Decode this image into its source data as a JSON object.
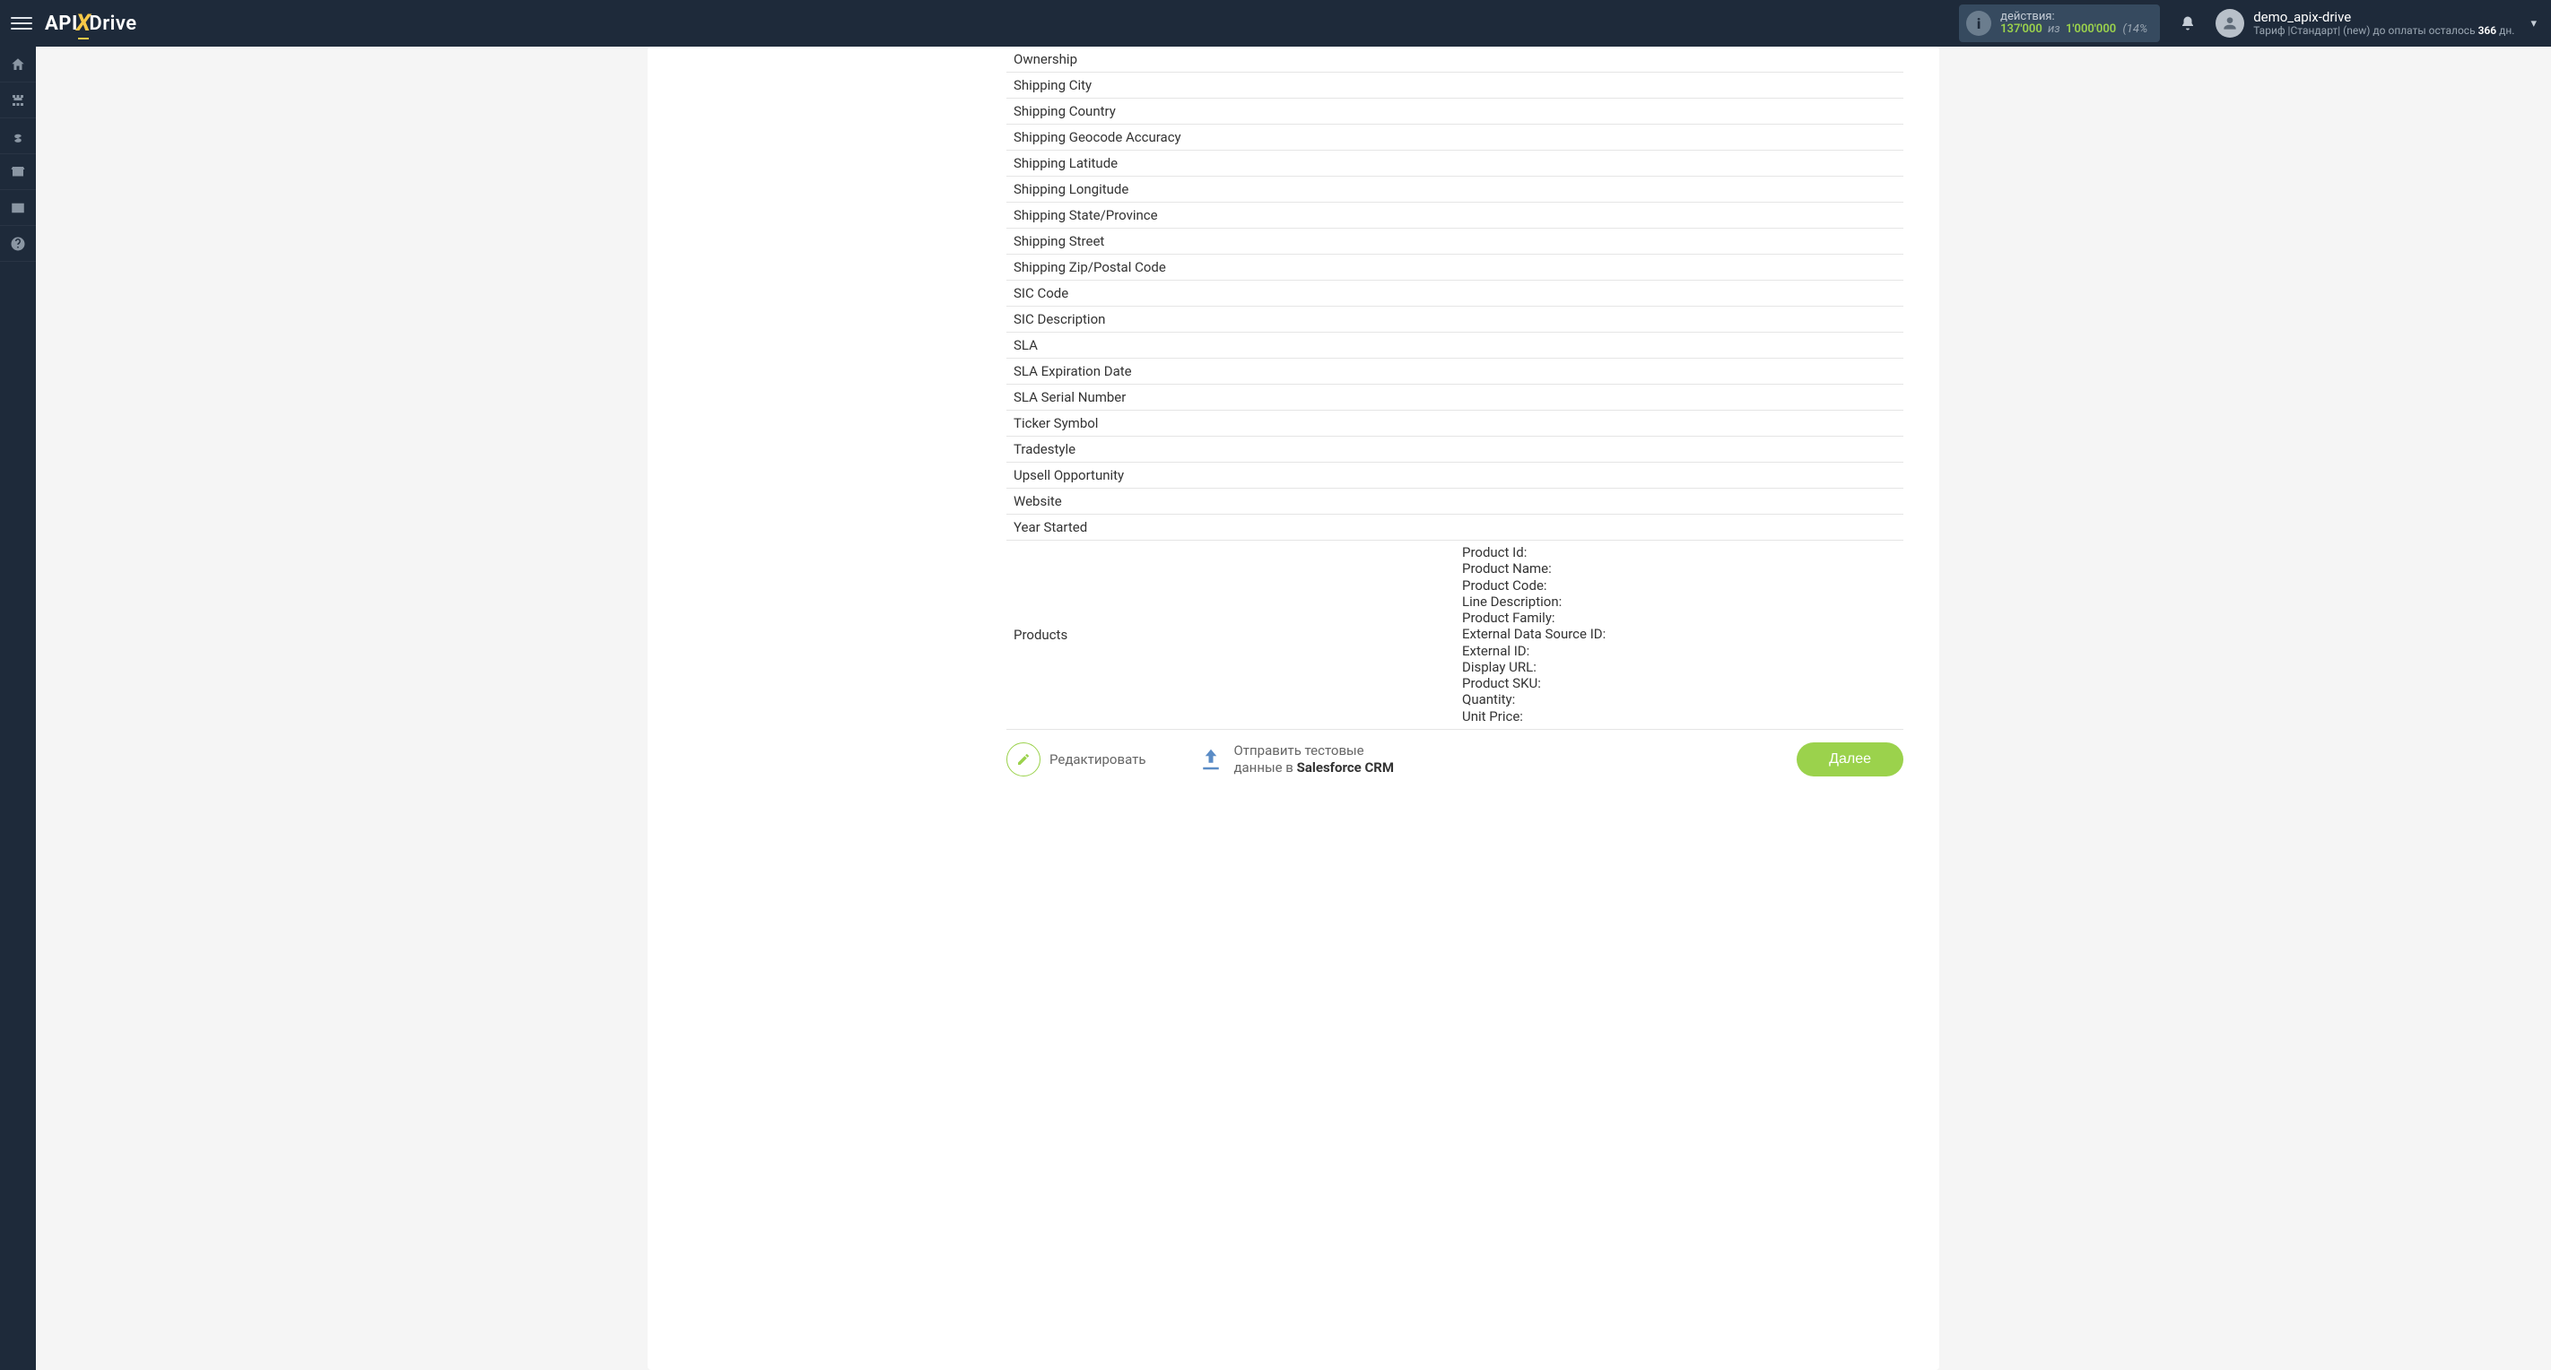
{
  "header": {
    "actions": {
      "label": "действия:",
      "used": "137'000",
      "of": "из",
      "total": "1'000'000",
      "pct": "(14%"
    },
    "user": {
      "name": "demo_apix-drive",
      "tariff_prefix": "Тариф |Стандарт| (new) до оплаты осталось ",
      "days": "366",
      "days_suffix": " дн."
    }
  },
  "fields": [
    "Ownership",
    "Shipping City",
    "Shipping Country",
    "Shipping Geocode Accuracy",
    "Shipping Latitude",
    "Shipping Longitude",
    "Shipping State/Province",
    "Shipping Street",
    "Shipping Zip/Postal Code",
    "SIC Code",
    "SIC Description",
    "SLA",
    "SLA Expiration Date",
    "SLA Serial Number",
    "Ticker Symbol",
    "Tradestyle",
    "Upsell Opportunity",
    "Website",
    "Year Started"
  ],
  "products_label": "Products",
  "products_lines": [
    "Product Id:",
    "Product Name:",
    "Product Code:",
    "Line Description:",
    "Product Family:",
    "External Data Source ID:",
    "External ID:",
    "Display URL:",
    "Product SKU:",
    "Quantity:",
    "Unit Price:"
  ],
  "footer": {
    "edit_label": "Редактировать",
    "send_line1": "Отправить тестовые",
    "send_line2_prefix": "данные в ",
    "send_line2_bold": "Salesforce CRM",
    "next_label": "Далее"
  }
}
